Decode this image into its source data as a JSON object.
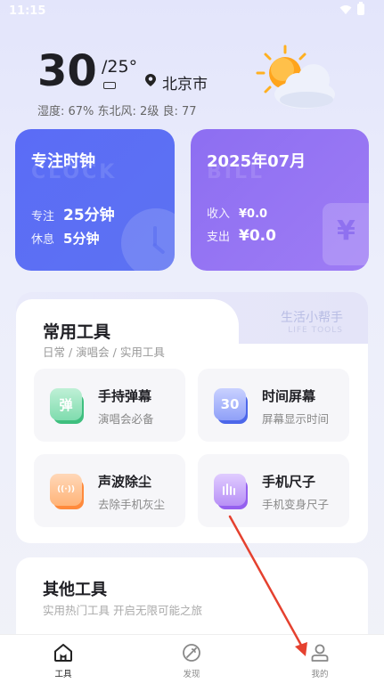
{
  "status_bar": {
    "time": "11:15"
  },
  "weather": {
    "temp_high": "30",
    "temp_low": "/25°",
    "location": "北京市",
    "detail": "湿度: 67%   东北风: 2级   良: 77"
  },
  "focus_card": {
    "title": "专注时钟",
    "bg_text": "CLOCK",
    "focus_label": "专注",
    "focus_value": "25分钟",
    "rest_label": "休息",
    "rest_value": "5分钟"
  },
  "bill_card": {
    "title": "2025年07月",
    "bg_text": "BILL",
    "income_label": "收入",
    "income_value": "¥0.0",
    "expense_label": "支出",
    "expense_value": "¥0.0",
    "deco_glyph": "¥"
  },
  "common_tools": {
    "title": "常用工具",
    "subtitle": "日常 / 演唱会 / 实用工具",
    "side_title": "生活小帮手",
    "side_title_en": "LIFE TOOLS",
    "items": [
      {
        "name": "手持弹幕",
        "desc": "演唱会必备",
        "icon_text": "弹",
        "icon": "danmaku-icon"
      },
      {
        "name": "时间屏幕",
        "desc": "屏幕显示时间",
        "icon_text": "30",
        "icon": "time-screen-icon"
      },
      {
        "name": "声波除尘",
        "desc": "去除手机灰尘",
        "icon_text": "((·))",
        "icon": "sonic-icon"
      },
      {
        "name": "手机尺子",
        "desc": "手机变身尺子",
        "icon_text": "",
        "icon": "ruler-icon"
      }
    ]
  },
  "other_tools": {
    "title": "其他工具",
    "subtitle": "实用热门工具 开启无限可能之旅"
  },
  "tabbar": {
    "items": [
      {
        "label": "工具",
        "icon": "home-icon",
        "active": true
      },
      {
        "label": "发现",
        "icon": "discover-icon",
        "active": false
      },
      {
        "label": "我的",
        "icon": "user-icon",
        "active": false
      }
    ]
  },
  "colors": {
    "focus_card": "#5c70f4",
    "bill_card": "#9677f3",
    "annotation_arrow": "#e5412f"
  }
}
